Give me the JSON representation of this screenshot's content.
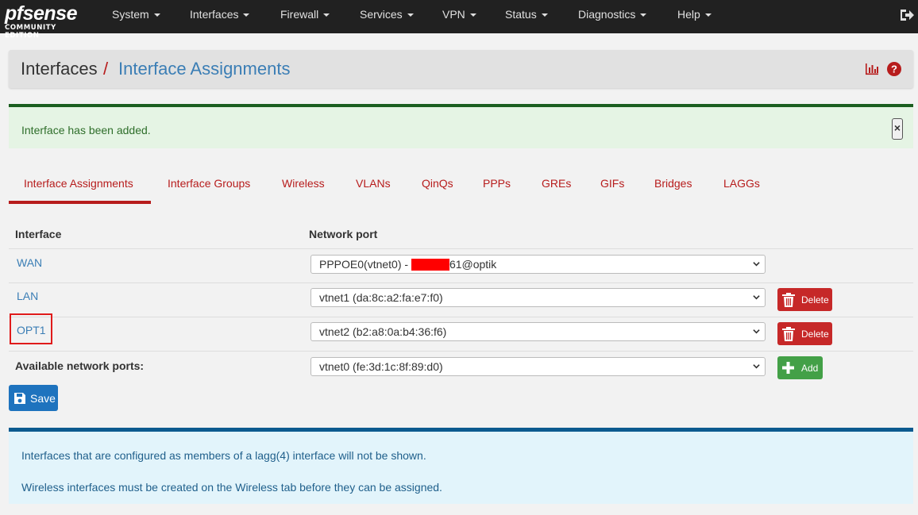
{
  "brand": {
    "main": "pfsense",
    "sub": "COMMUNITY EDITION"
  },
  "nav": [
    "System",
    "Interfaces",
    "Firewall",
    "Services",
    "VPN",
    "Status",
    "Diagnostics",
    "Help"
  ],
  "header": {
    "crumb1": "Interfaces",
    "separator": "/",
    "crumb2": "Interface Assignments"
  },
  "alert_success": {
    "message": "Interface has been added.",
    "close": "×"
  },
  "tabs": [
    "Interface Assignments",
    "Interface Groups",
    "Wireless",
    "VLANs",
    "QinQs",
    "PPPs",
    "GREs",
    "GIFs",
    "Bridges",
    "LAGGs"
  ],
  "active_tab": "Interface Assignments",
  "table": {
    "headers": {
      "interface": "Interface",
      "port": "Network port"
    },
    "rows": [
      {
        "name": "WAN",
        "port_prefix": "PPPOE0(vtnet0) - ",
        "port_suffix": "61@optik",
        "deletable": false
      },
      {
        "name": "LAN",
        "port": "vtnet1 (da:8c:a2:fa:e7:f0)",
        "deletable": true
      },
      {
        "name": "OPT1",
        "port": "vtnet2 (b2:a8:0a:b4:36:f6)",
        "deletable": true,
        "highlighted": true
      }
    ],
    "available": {
      "label": "Available network ports:",
      "port": "vtnet0 (fe:3d:1c:8f:89:d0)"
    }
  },
  "buttons": {
    "delete": "Delete",
    "add": "Add",
    "save": "Save"
  },
  "info": [
    "Interfaces that are configured as members of a lagg(4) interface will not be shown.",
    "Wireless interfaces must be created on the Wireless tab before they can be assigned."
  ],
  "colors": {
    "navbar": "#212121",
    "accent_red": "#b71c1c",
    "link_blue": "#3b7eb5",
    "success_green": "#43a047",
    "save_blue": "#1e73be"
  }
}
